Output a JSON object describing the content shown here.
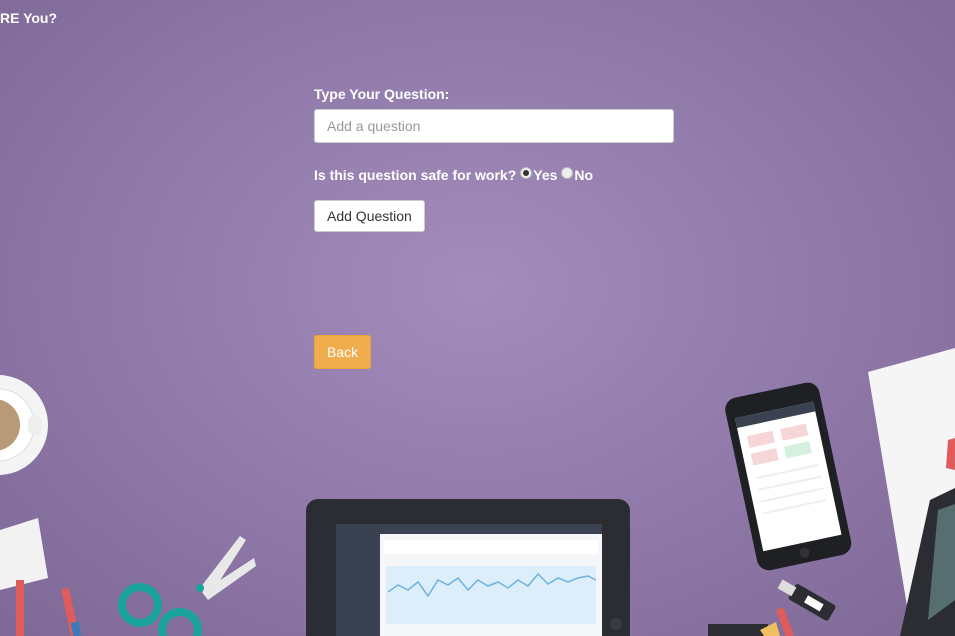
{
  "header": {
    "brand_text": "RE You?"
  },
  "form": {
    "question_label": "Type Your Question:",
    "question_placeholder": "Add a question",
    "question_value": "",
    "sfw_label": "Is this question safe for work?",
    "sfw_options": [
      {
        "label": "Yes",
        "selected": true
      },
      {
        "label": "No",
        "selected": false
      }
    ],
    "add_button_label": "Add Question"
  },
  "nav": {
    "back_button_label": "Back"
  },
  "colors": {
    "background": "#9680af",
    "back_button": "#f0ad4e"
  }
}
